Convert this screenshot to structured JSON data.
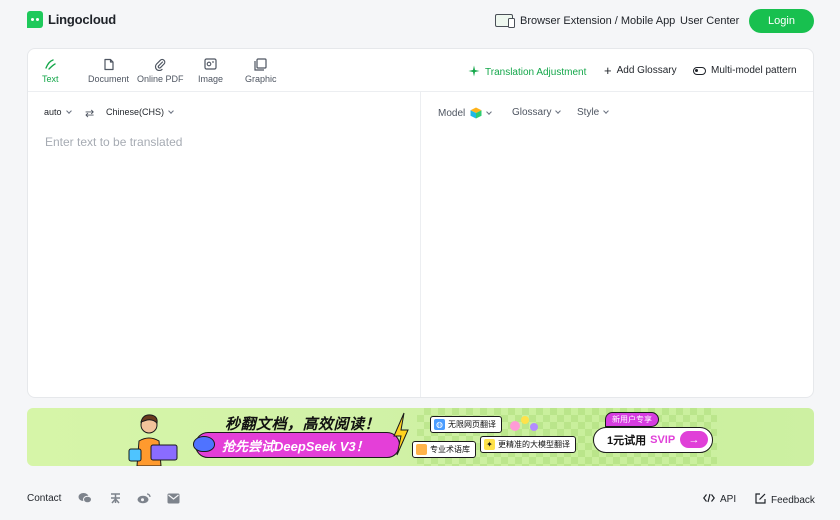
{
  "header": {
    "logo_text": "Lingocloud",
    "extension_label": "Browser Extension / Mobile App",
    "user_center_label": "User Center",
    "login_label": "Login"
  },
  "tabs": [
    {
      "label": "Text",
      "icon": "pen-icon",
      "active": true
    },
    {
      "label": "Document",
      "icon": "document-icon",
      "active": false
    },
    {
      "label": "Online PDF",
      "icon": "paperclip-icon",
      "active": false
    },
    {
      "label": "Image",
      "icon": "image-icon",
      "active": false
    },
    {
      "label": "Graphic",
      "icon": "graphic-icon",
      "active": false
    }
  ],
  "actions": {
    "translation_adjustment": "Translation Adjustment",
    "add_glossary": "Add Glossary",
    "multi_model": "Multi-model pattern"
  },
  "source": {
    "source_lang": "auto",
    "target_lang": "Chinese(CHS)",
    "placeholder": "Enter text to be translated"
  },
  "target_options": {
    "model_label": "Model",
    "glossary_label": "Glossary",
    "style_label": "Style"
  },
  "banner": {
    "headline": "秒翻文档，高效阅读！",
    "pill_text": "抢先尝试DeepSeek V3！",
    "chip_1": "无限网页翻译",
    "chip_2": "专业术语库",
    "chip_3": "更精准的大模型翻译",
    "new_user_tag": "新用户专享",
    "cta_prefix": "1元试用",
    "cta_svip": "SVIP",
    "cta_arrow": "→"
  },
  "footer": {
    "contact_label": "Contact",
    "api_label": "API",
    "feedback_label": "Feedback"
  },
  "colors": {
    "brand_green": "#18c04f",
    "active_tab": "#14a74a",
    "banner_pink": "#e43fd8"
  }
}
